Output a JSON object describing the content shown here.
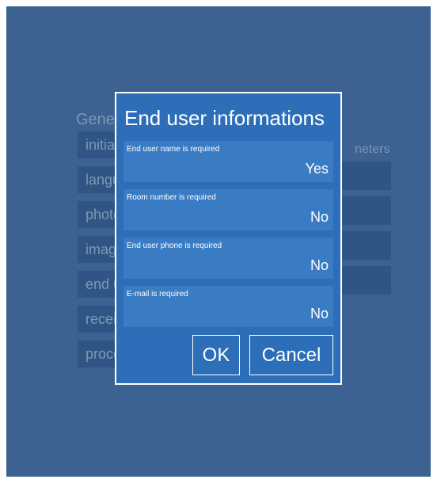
{
  "background": {
    "section_title": "Gener",
    "items": [
      "initial",
      "langu",
      "photo",
      "image",
      "end u",
      "receip",
      "proce"
    ],
    "right_title": "neters"
  },
  "dialog": {
    "title": "End user informations",
    "rows": [
      {
        "label": "End user name is required",
        "value": "Yes"
      },
      {
        "label": "Room number is required",
        "value": "No"
      },
      {
        "label": "End user phone is required",
        "value": "No"
      },
      {
        "label": "E-mail is required",
        "value": "No"
      }
    ],
    "ok_label": "OK",
    "cancel_label": "Cancel"
  },
  "colors": {
    "screen_bg": "#3b6290",
    "dialog_bg": "#2d6eb8",
    "row_bg": "#3a7cc4",
    "border": "#ffffff"
  }
}
